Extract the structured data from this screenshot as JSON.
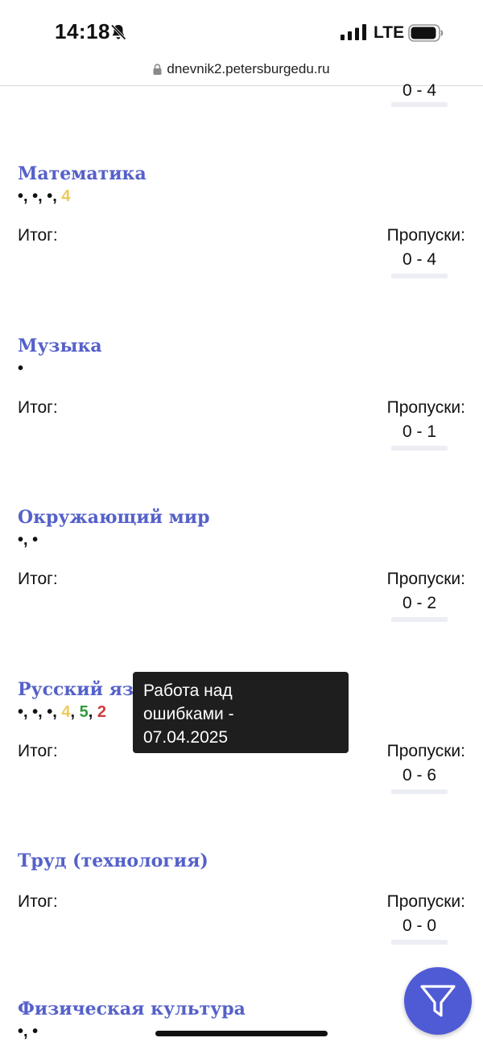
{
  "status_bar": {
    "time": "14:18",
    "network": "LTE"
  },
  "browser": {
    "url": "dnevnik2.petersburgedu.ru"
  },
  "labels": {
    "itog": "Итог:",
    "skips": "Пропуски:"
  },
  "top_partial": {
    "skips_value": "0 - 4"
  },
  "subjects": [
    {
      "name": "Математика",
      "marks": [
        {
          "text": "•",
          "color": "default"
        },
        {
          "text": "•",
          "color": "default"
        },
        {
          "text": "•",
          "color": "default"
        },
        {
          "text": "4",
          "color": "#f0c85a"
        }
      ],
      "skips_value": "0 - 4"
    },
    {
      "name": "Музыка",
      "marks": [
        {
          "text": "•",
          "color": "default"
        }
      ],
      "skips_value": "0 - 1"
    },
    {
      "name": "Окружающий мир",
      "marks": [
        {
          "text": "•",
          "color": "default"
        },
        {
          "text": "•",
          "color": "default"
        }
      ],
      "skips_value": "0 - 2"
    },
    {
      "name": "Русский язык",
      "marks": [
        {
          "text": "•",
          "color": "default"
        },
        {
          "text": "•",
          "color": "default"
        },
        {
          "text": "•",
          "color": "default"
        },
        {
          "text": "4",
          "color": "#f0c85a"
        },
        {
          "text": "5",
          "color": "#2e9b3a"
        },
        {
          "text": "2",
          "color": "#cf3a3a"
        }
      ],
      "skips_value": "0 - 6"
    },
    {
      "name": "Труд (технология)",
      "marks": [],
      "skips_value": "0 - 0"
    },
    {
      "name": "Физическая культура",
      "marks": [
        {
          "text": "•",
          "color": "default"
        },
        {
          "text": "•",
          "color": "default"
        }
      ],
      "skips_value": ""
    }
  ],
  "tooltip": {
    "line1": "Работа над",
    "line2": "ошибками -",
    "line3": "07.04.2025"
  },
  "fab": {
    "icon": "filter-icon",
    "color": "#4f5bd5"
  },
  "colors": {
    "subject_title": "#5561c9",
    "tooltip_bg": "#1e1e1e"
  }
}
